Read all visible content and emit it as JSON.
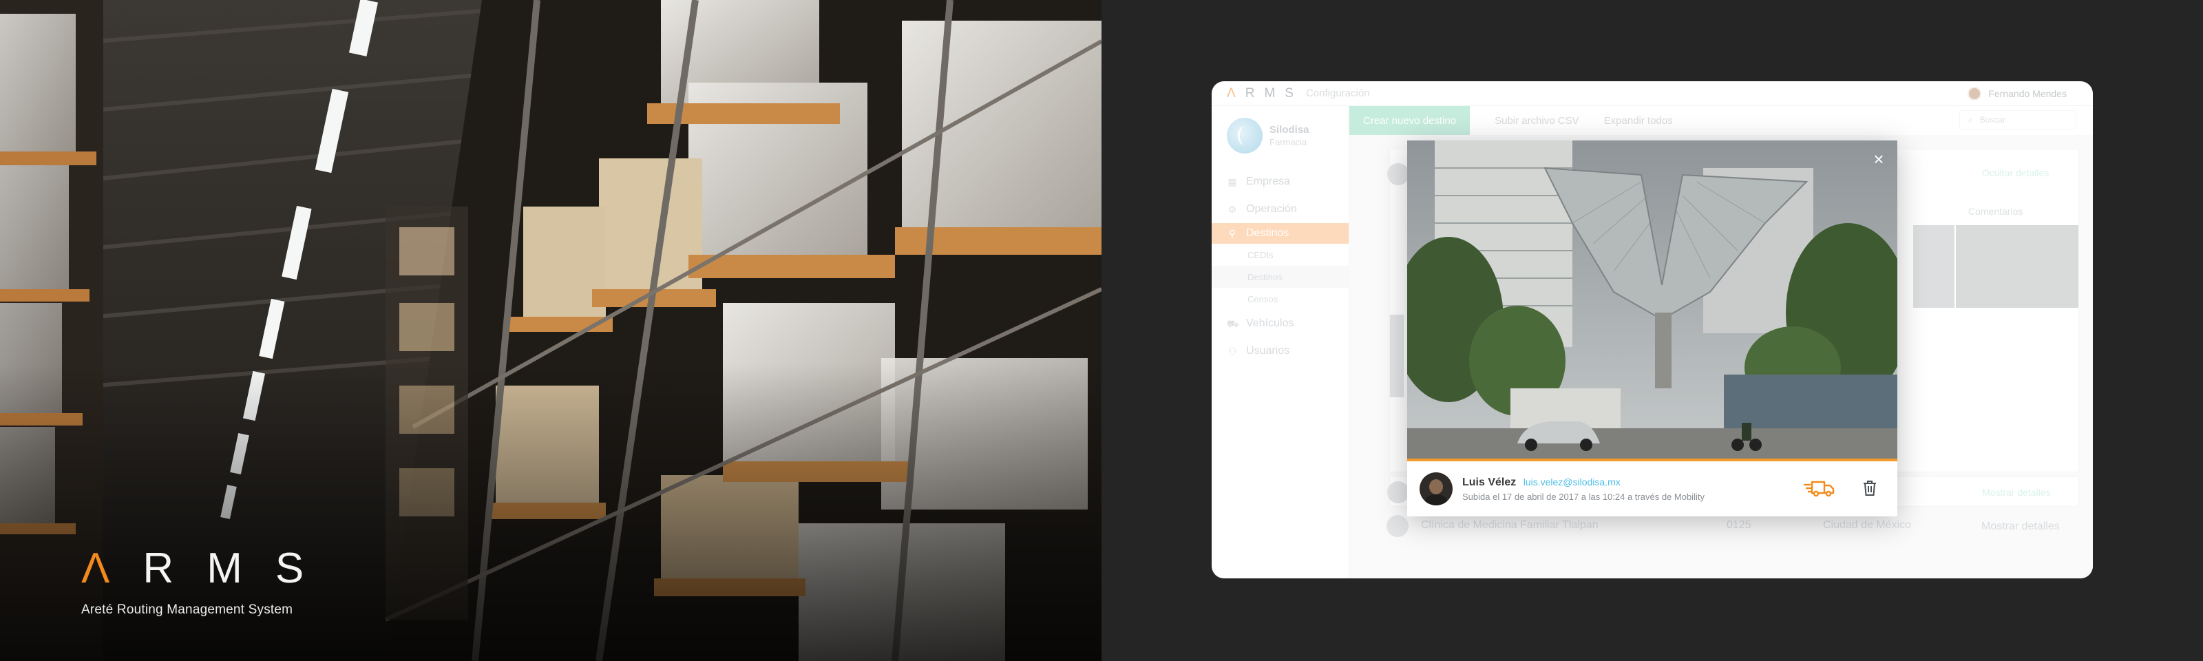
{
  "hero": {
    "logo_letters": [
      "Λ",
      "R",
      "M",
      "S"
    ],
    "tagline": "Areté Routing Management System"
  },
  "app": {
    "topbar": {
      "logo_letters": [
        "Λ",
        "R",
        "M",
        "S"
      ],
      "section": "Configuración",
      "user_name": "Fernando Mendes"
    },
    "company": {
      "name": "Silodisa",
      "subtitle": "Farmacia"
    },
    "nav": [
      {
        "label": "Empresa",
        "icon": "building-icon"
      },
      {
        "label": "Operación",
        "icon": "gear-icon"
      },
      {
        "label": "Destinos",
        "icon": "map-pin-icon",
        "active": true
      },
      {
        "label": "Vehículos",
        "icon": "truck-icon"
      },
      {
        "label": "Usuarios",
        "icon": "user-icon"
      }
    ],
    "subnav": [
      "CEDIs",
      "Destinos",
      "Censos"
    ],
    "toolbar": {
      "create_label": "Crear nuevo destino",
      "upload_label": "Subir archivo CSV",
      "expand_label": "Expandir todos",
      "search_placeholder": "Buscar"
    },
    "content": {
      "hide_details": "Ocultar detalles",
      "comments": "Comentarios",
      "show_details": "Mostrar detalles",
      "row": {
        "name": "Clínica de Medicina Familiar Tlalpan",
        "code": "0125",
        "city": "Ciudad de México"
      }
    },
    "modal": {
      "uploader_name": "Luis Vélez",
      "uploader_email": "luis.velez@silodisa.mx",
      "upload_meta": "Subida el 17 de abril de 2017 a las 10:24 a través de Mobility",
      "close_icon": "×"
    },
    "colors": {
      "accent_orange": "#f28a1c",
      "accent_green": "#a8e2cc",
      "link_blue": "#4dbde6",
      "nav_active": "#fdc79a"
    }
  }
}
